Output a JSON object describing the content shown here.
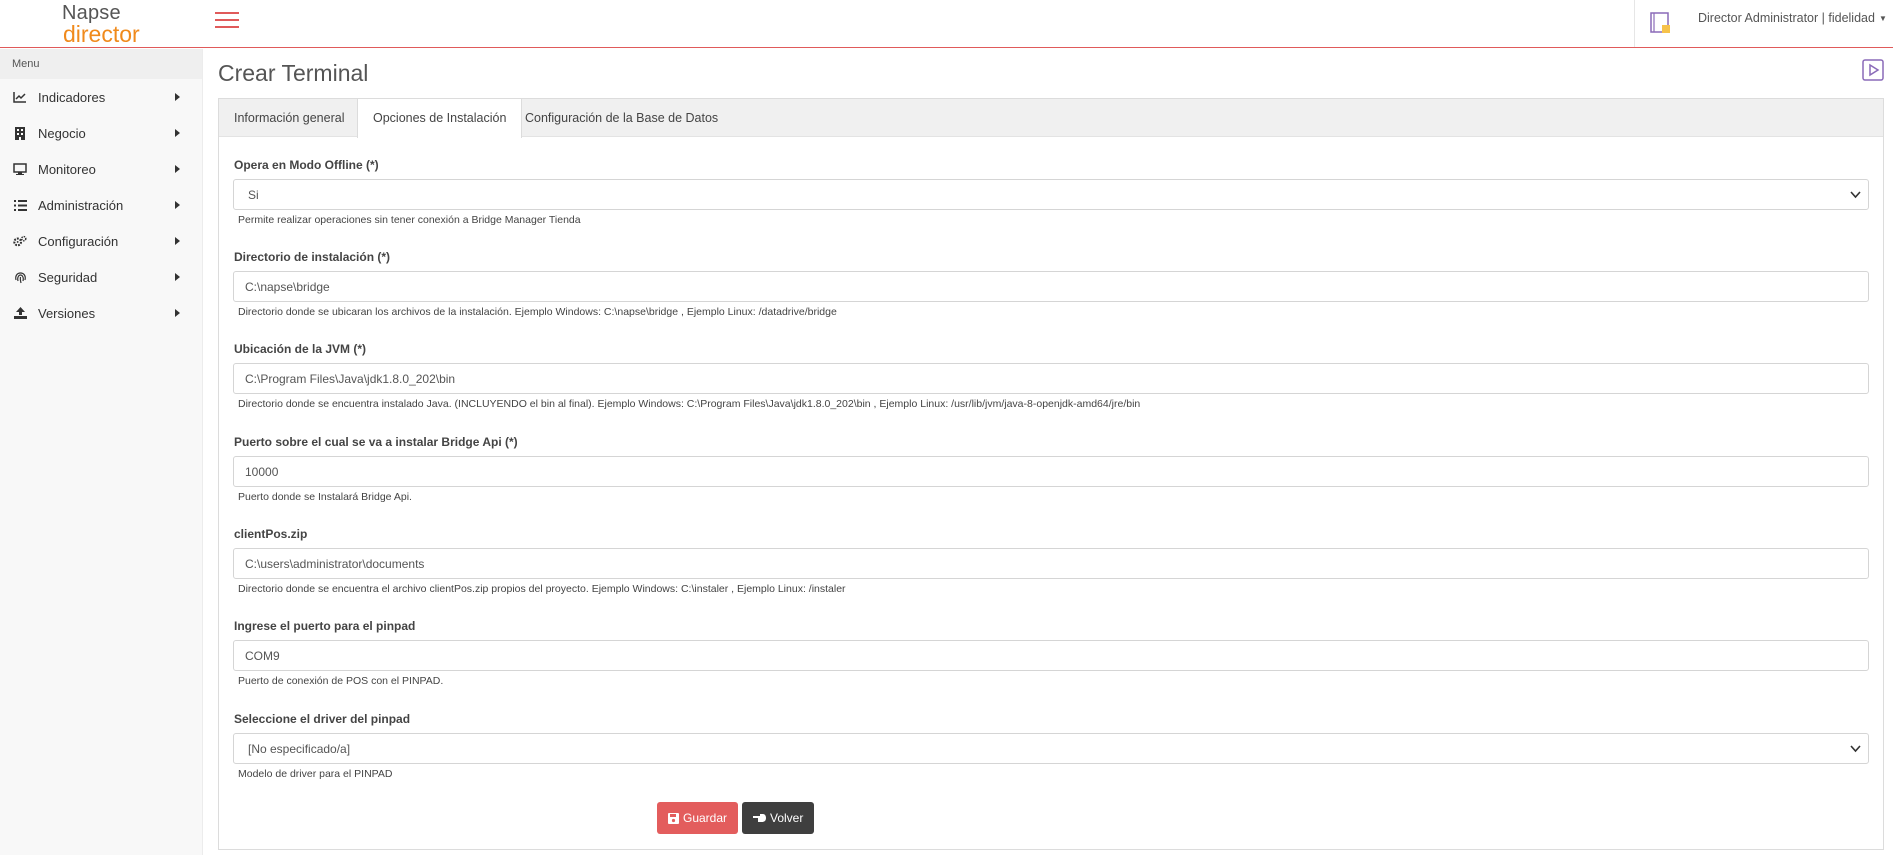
{
  "header": {
    "logo_line1": "Napse",
    "logo_line2": "director",
    "user_label": "Director Administrator | fidelidad",
    "accent_color": "#e05a5a",
    "brand_orange": "#f08a1c"
  },
  "sidebar": {
    "title": "Menu",
    "items": [
      {
        "label": "Indicadores",
        "icon": "chart-line-icon"
      },
      {
        "label": "Negocio",
        "icon": "building-icon"
      },
      {
        "label": "Monitoreo",
        "icon": "desktop-icon"
      },
      {
        "label": "Administración",
        "icon": "list-icon"
      },
      {
        "label": "Configuración",
        "icon": "gears-icon"
      },
      {
        "label": "Seguridad",
        "icon": "fingerprint-icon"
      },
      {
        "label": "Versiones",
        "icon": "upload-icon"
      }
    ]
  },
  "main": {
    "title": "Crear Terminal",
    "tabs": [
      {
        "label": "Información general",
        "active": false
      },
      {
        "label": "Opciones de Instalación",
        "active": true
      },
      {
        "label": "Configuración de la Base de Datos",
        "active": false
      }
    ],
    "fields": [
      {
        "label": "Opera en Modo Offline (*)",
        "value": "Si",
        "type": "select",
        "help": "Permite realizar operaciones sin tener conexión a Bridge Manager Tienda"
      },
      {
        "label": "Directorio de instalación (*)",
        "value": "C:\\napse\\bridge",
        "type": "text",
        "help": "Directorio donde se ubicaran los archivos de la instalación. Ejemplo Windows: C:\\napse\\bridge , Ejemplo Linux: /datadrive/bridge"
      },
      {
        "label": "Ubicación de la JVM (*)",
        "value": "C:\\Program Files\\Java\\jdk1.8.0_202\\bin",
        "type": "text",
        "help": "Directorio donde se encuentra instalado Java. (INCLUYENDO el bin al final). Ejemplo Windows: C:\\Program Files\\Java\\jdk1.8.0_202\\bin , Ejemplo Linux: /usr/lib/jvm/java-8-openjdk-amd64/jre/bin"
      },
      {
        "label": "Puerto sobre el cual se va a instalar Bridge Api (*)",
        "value": "10000",
        "type": "text",
        "help": "Puerto donde se Instalará Bridge Api."
      },
      {
        "label": "clientPos.zip",
        "value": "C:\\users\\administrator\\documents",
        "type": "text",
        "help": "Directorio donde se encuentra el archivo clientPos.zip propios del proyecto. Ejemplo Windows: C:\\instaler , Ejemplo Linux: /instaler"
      },
      {
        "label": "Ingrese el puerto para el pinpad",
        "value": "COM9",
        "type": "text",
        "help": "Puerto de conexión de POS con el PINPAD."
      },
      {
        "label": "Seleccione el driver del pinpad",
        "value": "[No especificado/a]",
        "type": "select",
        "help": "Modelo de driver para el PINPAD"
      }
    ],
    "buttons": {
      "save_label": "Guardar",
      "back_label": "Volver"
    }
  }
}
